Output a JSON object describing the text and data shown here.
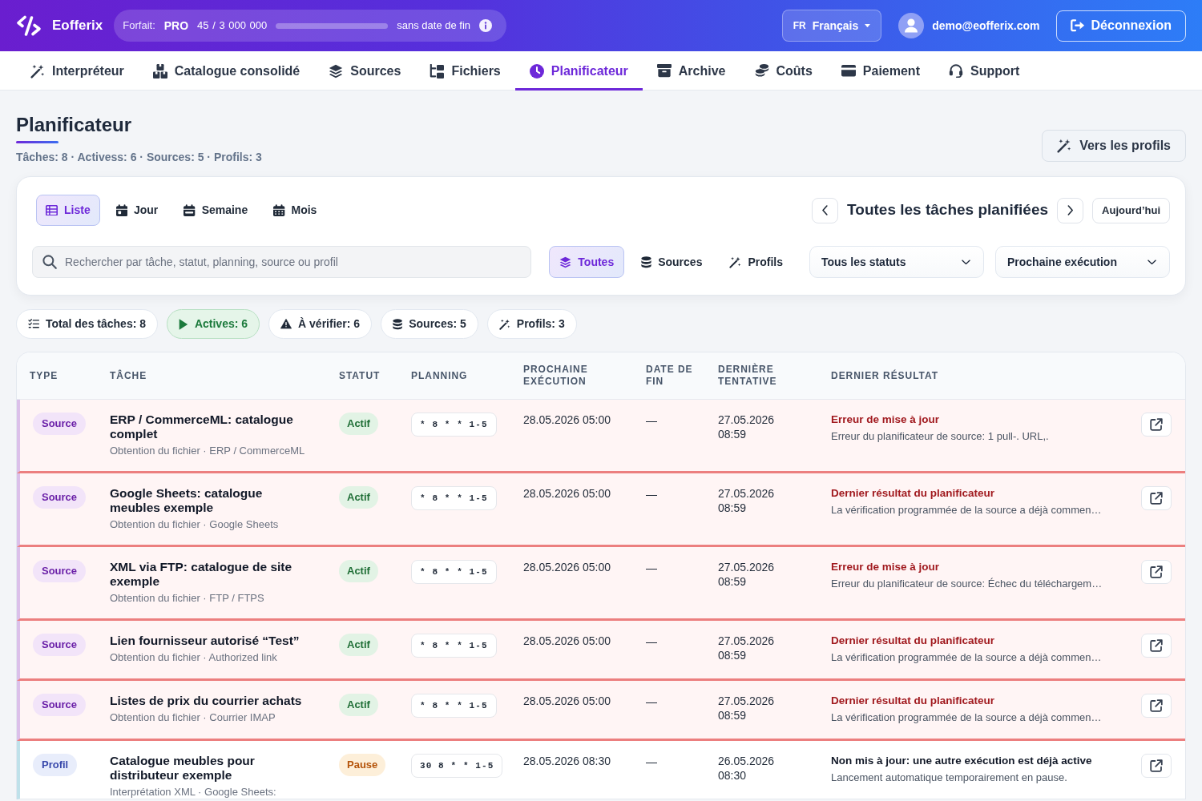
{
  "brand": {
    "name": "Eofferix"
  },
  "plan": {
    "label": "Forfait:",
    "tier": "PRO",
    "usage": "45 / 3 000 000",
    "level": 0,
    "expiry": "sans date de fin"
  },
  "language": {
    "code": "FR",
    "name": "Français"
  },
  "user": {
    "email": "demo@eofferix.com"
  },
  "logout": {
    "label": "Déconnexion"
  },
  "nav": [
    {
      "label": "Interpréteur",
      "selected": false
    },
    {
      "label": "Catalogue consolidé",
      "selected": false
    },
    {
      "label": "Sources",
      "selected": false
    },
    {
      "label": "Fichiers",
      "selected": false
    },
    {
      "label": "Planificateur",
      "selected": true
    },
    {
      "label": "Archive",
      "selected": false
    },
    {
      "label": "Coûts",
      "selected": false
    },
    {
      "label": "Paiement",
      "selected": false
    },
    {
      "label": "Support",
      "selected": false
    }
  ],
  "page": {
    "title": "Planificateur",
    "summary": "Tâches: 8 · Activess: 6 · Sources: 5 · Profils: 3",
    "action": "Vers les profils"
  },
  "filters": {
    "views": [
      {
        "label": "Liste",
        "selected": true
      },
      {
        "label": "Jour",
        "selected": false
      },
      {
        "label": "Semaine",
        "selected": false
      },
      {
        "label": "Mois",
        "selected": false
      }
    ],
    "period_title": "Toutes les tâches planifiées",
    "today": "Aujourd’hui",
    "search": {
      "placeholder": "Rechercher par tâche, statut, planning, source ou profil"
    },
    "scope": [
      {
        "label": "Toutes",
        "selected": true
      },
      {
        "label": "Sources",
        "selected": false
      },
      {
        "label": "Profils",
        "selected": false
      }
    ],
    "status_select": {
      "value": "Tous les statuts"
    },
    "sort_select": {
      "value": "Prochaine exécution"
    }
  },
  "stats": [
    {
      "label": "Total des tâches: 8",
      "kind": "plain"
    },
    {
      "label": "Actives: 6",
      "kind": "success"
    },
    {
      "label": "À vérifier: 6",
      "kind": "plain"
    },
    {
      "label": "Sources: 5",
      "kind": "plain"
    },
    {
      "label": "Profils: 3",
      "kind": "plain"
    }
  ],
  "table": {
    "columns": [
      "TYPE",
      "TÂCHE",
      "STATUT",
      "PLANNING",
      "PROCHAINE EXÉCUTION",
      "DATE DE FIN",
      "DERNIÈRE TENTATIVE",
      "DERNIER RÉSULTAT"
    ],
    "rows": [
      {
        "kind": "source",
        "type": "Source",
        "task": "ERP / CommerceML: catalogue complet",
        "detail": "Obtention du fichier · ERP / CommerceML",
        "status": {
          "label": "Actif",
          "kind": "active"
        },
        "schedule": "* 8 * * 1-5",
        "next_run": "28.05.2026 05:00",
        "end_date": "—",
        "last_attempt": "27.05.2026 08:59",
        "result_title": "Erreur de mise à jour",
        "result_detail": "Erreur du planificateur de source: 1 pull-. URL,.",
        "alert": true
      },
      {
        "kind": "source",
        "type": "Source",
        "task": "Google Sheets: catalogue meubles exemple",
        "detail": "Obtention du fichier · Google Sheets",
        "status": {
          "label": "Actif",
          "kind": "active"
        },
        "schedule": "* 8 * * 1-5",
        "next_run": "28.05.2026 05:00",
        "end_date": "—",
        "last_attempt": "27.05.2026 08:59",
        "result_title": "Dernier résultat du planificateur",
        "result_detail": "La vérification programmée de la source a déjà commen…",
        "alert": true
      },
      {
        "kind": "source",
        "type": "Source",
        "task": "XML via FTP: catalogue de site exemple",
        "detail": "Obtention du fichier · FTP / FTPS",
        "status": {
          "label": "Actif",
          "kind": "active"
        },
        "schedule": "* 8 * * 1-5",
        "next_run": "28.05.2026 05:00",
        "end_date": "—",
        "last_attempt": "27.05.2026 08:59",
        "result_title": "Erreur de mise à jour",
        "result_detail": "Erreur du planificateur de source: Échec du téléchargem…",
        "alert": true
      },
      {
        "kind": "source",
        "type": "Source",
        "task": "Lien fournisseur autorisé “Test”",
        "detail": "Obtention du fichier · Authorized link",
        "status": {
          "label": "Actif",
          "kind": "active"
        },
        "schedule": "* 8 * * 1-5",
        "next_run": "28.05.2026 05:00",
        "end_date": "—",
        "last_attempt": "27.05.2026 08:59",
        "result_title": "Dernier résultat du planificateur",
        "result_detail": "La vérification programmée de la source a déjà commen…",
        "alert": true
      },
      {
        "kind": "source",
        "type": "Source",
        "task": "Listes de prix du courrier achats",
        "detail": "Obtention du fichier · Courrier IMAP",
        "status": {
          "label": "Actif",
          "kind": "active"
        },
        "schedule": "* 8 * * 1-5",
        "next_run": "28.05.2026 05:00",
        "end_date": "—",
        "last_attempt": "27.05.2026 08:59",
        "result_title": "Dernier résultat du planificateur",
        "result_detail": "La vérification programmée de la source a déjà commen…",
        "alert": true
      },
      {
        "kind": "profil",
        "type": "Profil",
        "task": "Catalogue meubles pour distributeur exemple",
        "detail": "Interprétation XML · Google Sheets:",
        "status": {
          "label": "Pause",
          "kind": "paused"
        },
        "schedule": "30 8 * * 1-5",
        "next_run": "28.05.2026 08:30",
        "end_date": "—",
        "last_attempt": "26.05.2026 08:30",
        "result_title": "Non mis à jour: une autre exécution est déjà active",
        "result_detail": "Lancement automatique temporairement en pause.",
        "alert": false
      }
    ]
  }
}
